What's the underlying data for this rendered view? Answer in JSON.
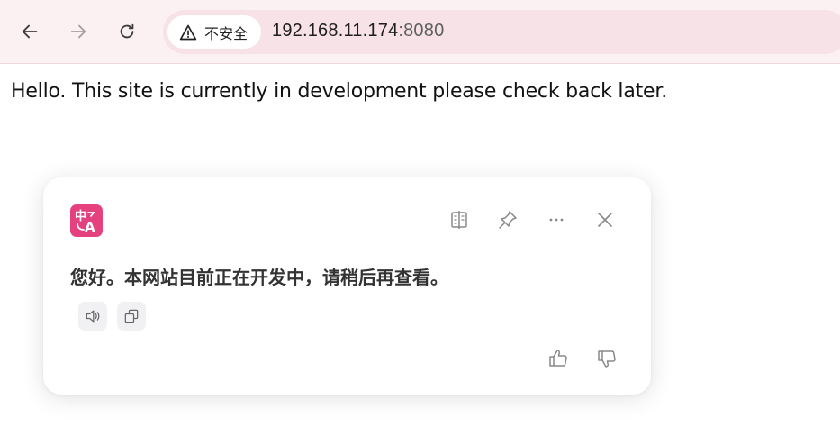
{
  "browser": {
    "security_label": "不安全",
    "url_host": "192.168.11.174",
    "url_port": ":8080",
    "icons": {
      "back": "arrow-left-icon",
      "forward": "arrow-right-icon",
      "reload": "reload-icon",
      "security": "warning-triangle-icon"
    }
  },
  "page": {
    "body_text": "Hello. This site is currently in development please check back later."
  },
  "translate_popup": {
    "translation": "您好。本网站目前正在开发中，请稍后再查看。",
    "accent_color": "#e5417f",
    "icons": {
      "logo": "translate-logo-icon",
      "compare": "bilingual-compare-icon",
      "pin": "pin-icon",
      "more": "more-horizontal-icon",
      "close": "close-icon",
      "speak": "speaker-icon",
      "copy": "copy-icon",
      "like": "thumbs-up-icon",
      "dislike": "thumbs-down-icon"
    }
  }
}
